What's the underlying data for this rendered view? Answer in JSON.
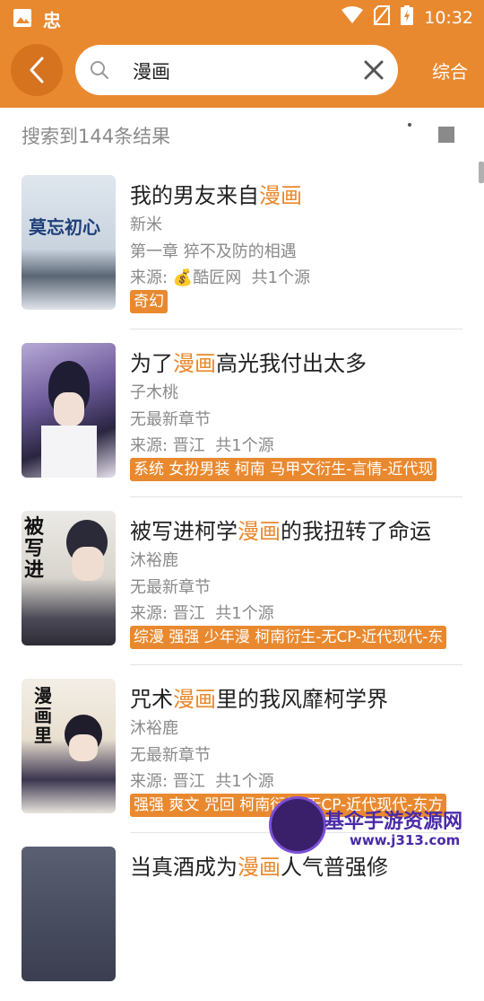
{
  "status_bar": {
    "time": "10:32",
    "app_glyph": "忠"
  },
  "toolbar": {
    "search_value": "漫画",
    "combine_label": "综合"
  },
  "result_count": "搜索到144条结果",
  "books": [
    {
      "title_before": "我的男友来自",
      "title_highlight": "漫画",
      "title_after": "",
      "author": "新米",
      "chapter": "第一章 猝不及防的相遇",
      "source_prefix": "来源: ",
      "source_icon": "💰",
      "source_name": "酷匠网",
      "source_count": "共1个源",
      "tags": "奇幻",
      "cover_text": "莫忘初心"
    },
    {
      "title_before": "为了",
      "title_highlight": "漫画",
      "title_after": "高光我付出太多",
      "author": "子木桃",
      "chapter": "无最新章节",
      "source_prefix": "来源: ",
      "source_icon": "",
      "source_name": "晋江",
      "source_count": "共1个源",
      "tags": "系统 女扮男装 柯南 马甲文衍生-言情-近代现",
      "cover_text": ""
    },
    {
      "title_before": "被写进柯学",
      "title_highlight": "漫画",
      "title_after": "的我扭转了命运",
      "author": "沐裕鹿",
      "chapter": "无最新章节",
      "source_prefix": "来源: ",
      "source_icon": "",
      "source_name": "晋江",
      "source_count": "共1个源",
      "tags": "综漫 强强 少年漫 柯南衍生-无CP-近代现代-东",
      "cover_text": "被写进"
    },
    {
      "title_before": "咒术",
      "title_highlight": "漫画",
      "title_after": "里的我风靡柯学界",
      "author": "沐裕鹿",
      "chapter": "无最新章节",
      "source_prefix": "来源: ",
      "source_icon": "",
      "source_name": "晋江",
      "source_count": "共1个源",
      "tags": "强强 爽文 咒回 柯南衍生-无CP-近代现代-东方",
      "cover_text": "漫画里"
    },
    {
      "title_before": "当真酒成为",
      "title_highlight": "漫画",
      "title_after": "人气普强修",
      "author": "",
      "chapter": "",
      "source_prefix": "",
      "source_icon": "",
      "source_name": "",
      "source_count": "",
      "tags": "",
      "cover_text": ""
    }
  ],
  "watermark": {
    "name": "基伞手游资源网",
    "url": "www.j313.com"
  },
  "colors": {
    "accent": "#e9892f",
    "accent_dark": "#d6731f",
    "muted_text": "#8a8a8a"
  }
}
